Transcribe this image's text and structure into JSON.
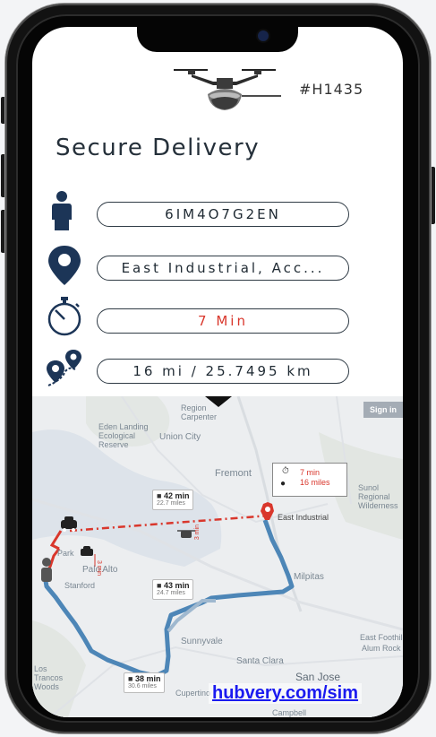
{
  "app": {
    "drone_id": "#H1435",
    "title": "Secure Delivery",
    "link_text": "hubvery.com/sim"
  },
  "fields": {
    "user_id": "6IM4O7G2EN",
    "address": "East Industrial, Acc...",
    "time": "7 Min",
    "distance": "16 mi / 25.7495 km"
  },
  "map": {
    "sign_in": "Sign in",
    "labels": [
      "Fremont",
      "Union City",
      "Palo Alto",
      "Stanford",
      "Sunnyvale",
      "Santa Clara",
      "San Jose",
      "Milpitas",
      "Cupertino",
      "Eden Landing Ecological Reserve",
      "East Industrial",
      "Sunol Regional Wilderness",
      "East Foothills",
      "Alum Rock",
      "Los Trancos Woods",
      "Campbell",
      "Park",
      "Carpenter",
      "Region"
    ],
    "callout": {
      "time": "7 min",
      "distance": "16 miles"
    },
    "route_boxes": [
      {
        "time": "42 min",
        "distance": "22.7 miles"
      },
      {
        "time": "43 min",
        "distance": "24.7 miles"
      },
      {
        "time": "38 min",
        "distance": "30.6 miles"
      }
    ],
    "drone_route_label": "3 min",
    "car_route_label": "3 min"
  },
  "colors": {
    "accent_red": "#d9372c",
    "route_blue": "#4d86b7",
    "icon_navy": "#1c3557",
    "link_blue": "#1a1af0"
  },
  "icons": [
    "drone-icon",
    "person-icon",
    "location-pin-icon",
    "stopwatch-icon",
    "route-pins-icon",
    "car-icon",
    "map-pin-icon",
    "down-triangle-icon"
  ]
}
